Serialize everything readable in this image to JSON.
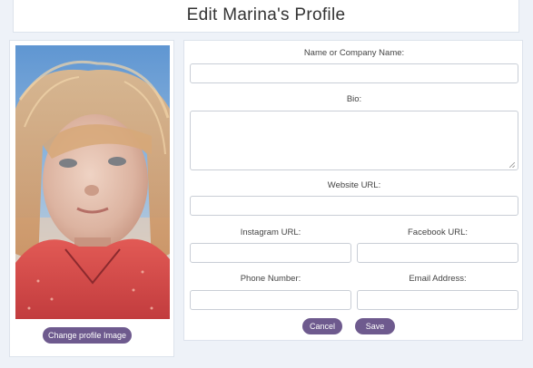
{
  "page": {
    "title": "Edit Marina's Profile"
  },
  "profile": {
    "change_image_label": "Change profile Image"
  },
  "form": {
    "name_label": "Name or Company Name:",
    "name_value": "",
    "bio_label": "Bio:",
    "bio_value": "",
    "website_label": "Website URL:",
    "website_value": "",
    "instagram_label": "Instagram URL:",
    "instagram_value": "",
    "facebook_label": "Facebook URL:",
    "facebook_value": "",
    "phone_label": "Phone Number:",
    "phone_value": "",
    "email_label": "Email Address:",
    "email_value": "",
    "cancel_label": "Cancel",
    "save_label": "Save"
  },
  "colors": {
    "accent": "#6e5a8e",
    "background": "#eef2f8"
  }
}
